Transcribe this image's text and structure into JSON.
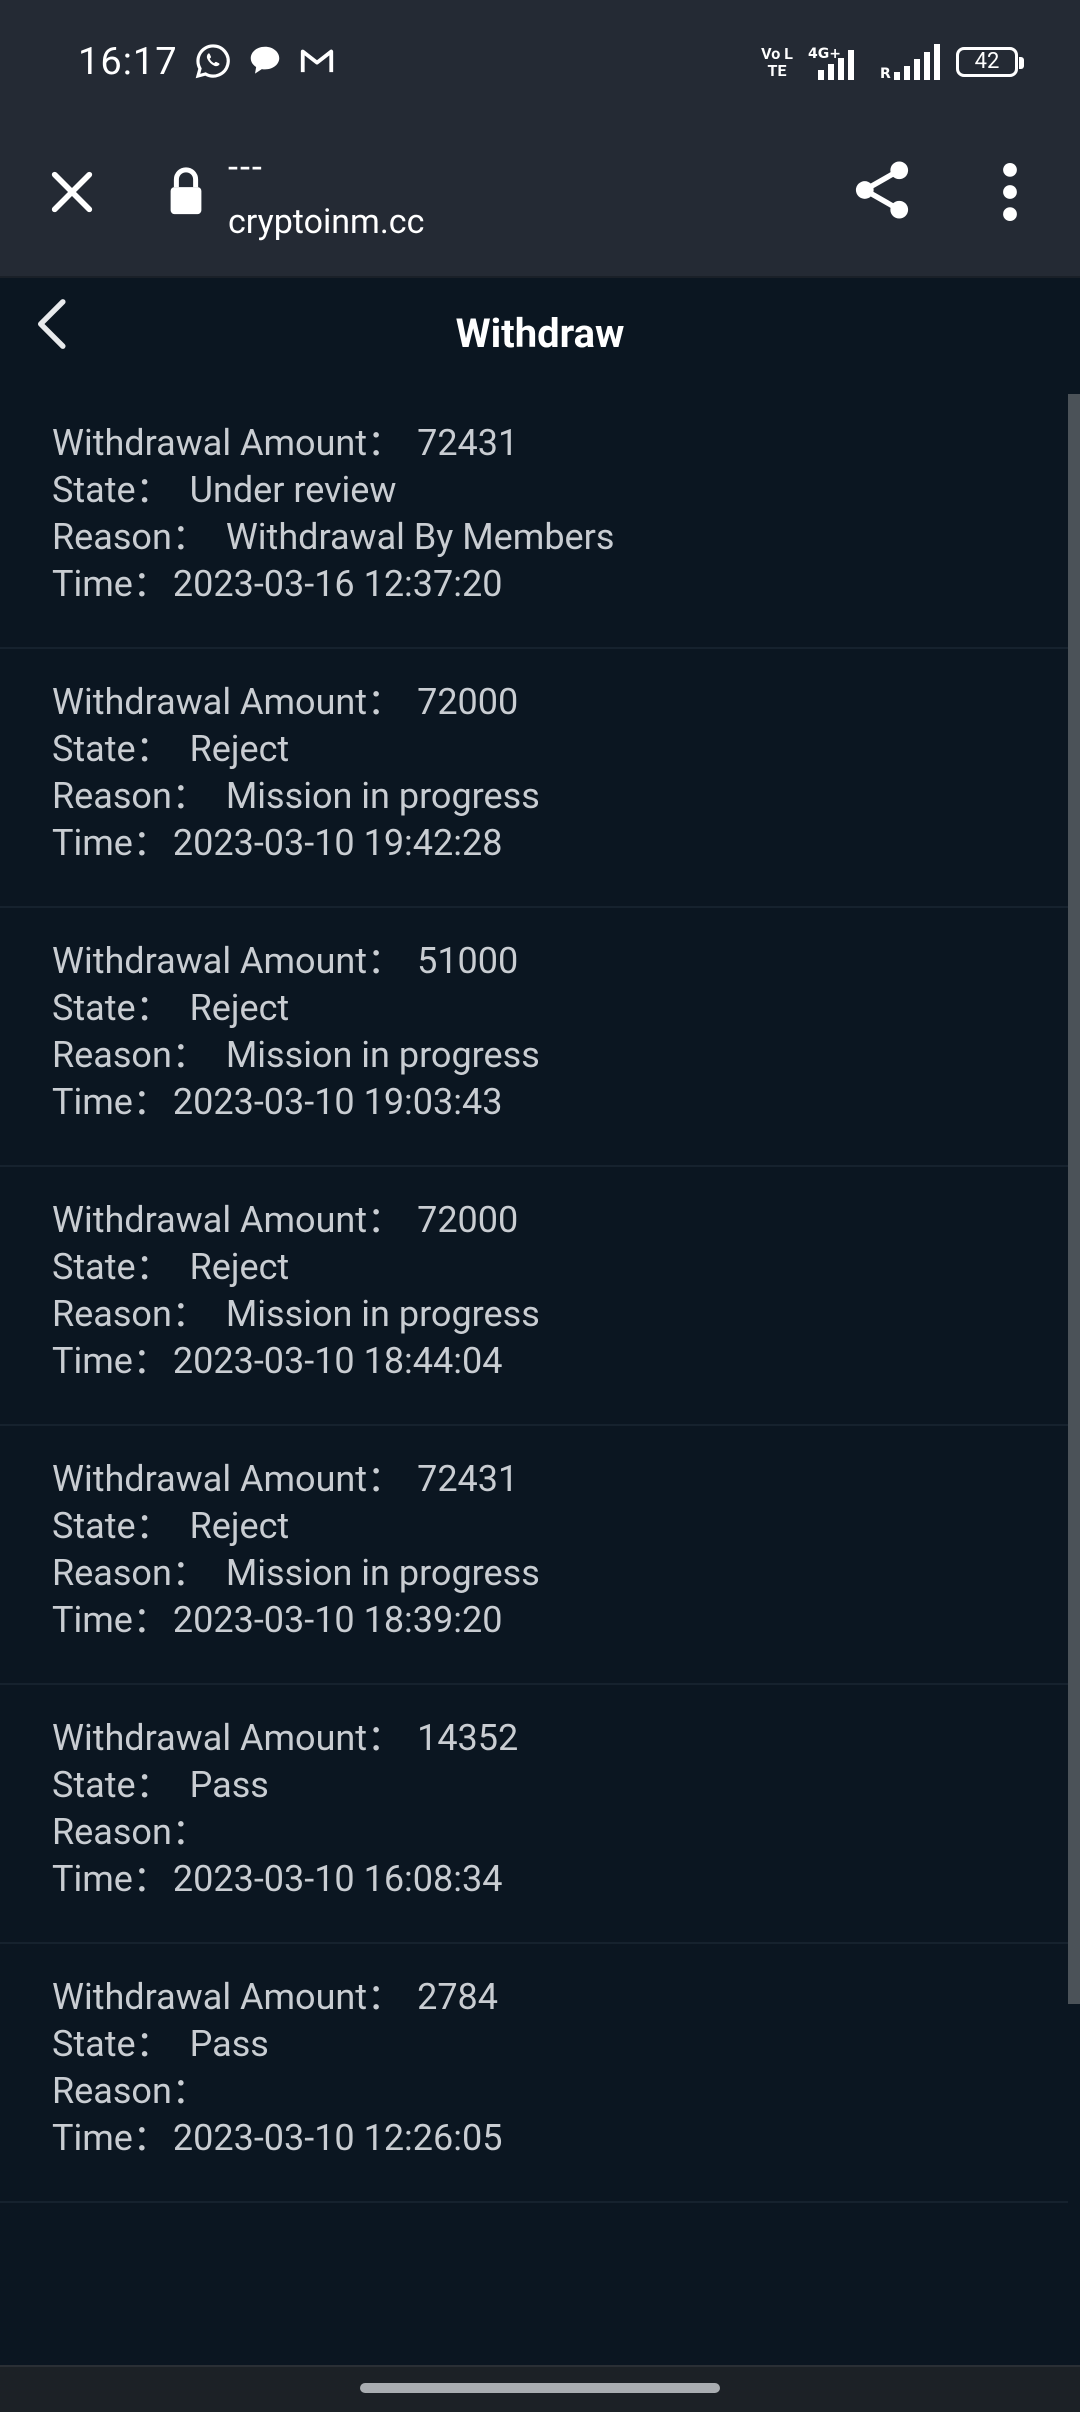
{
  "status_bar": {
    "time": "16:17",
    "volte_label": "Vo LTE",
    "network_label": "4G+",
    "battery_level": "42"
  },
  "browser": {
    "page_title": "---",
    "url": "cryptoinm.cc"
  },
  "header": {
    "title": "Withdraw"
  },
  "labels": {
    "amount": "Withdrawal Amount：",
    "state": "State：",
    "reason": "Reason：",
    "time": "Time："
  },
  "records": [
    {
      "amount": "72431",
      "state": "Under review",
      "reason": "Withdrawal By Members",
      "time": "2023-03-16 12:37:20"
    },
    {
      "amount": "72000",
      "state": "Reject",
      "reason": "Mission in progress",
      "time": "2023-03-10 19:42:28"
    },
    {
      "amount": "51000",
      "state": "Reject",
      "reason": "Mission in progress",
      "time": "2023-03-10 19:03:43"
    },
    {
      "amount": "72000",
      "state": "Reject",
      "reason": "Mission in progress",
      "time": "2023-03-10 18:44:04"
    },
    {
      "amount": "72431",
      "state": "Reject",
      "reason": "Mission in progress",
      "time": "2023-03-10 18:39:20"
    },
    {
      "amount": "14352",
      "state": "Pass",
      "reason": "",
      "time": "2023-03-10 16:08:34"
    },
    {
      "amount": "2784",
      "state": "Pass",
      "reason": "",
      "time": "2023-03-10 12:26:05"
    }
  ],
  "icons": {
    "status": [
      "whatsapp-icon",
      "chat-bubble-icon",
      "gmail-icon",
      "signal-icon",
      "battery-icon"
    ],
    "browser": [
      "close-icon",
      "lock-icon",
      "share-icon",
      "more-vert-icon"
    ],
    "header": [
      "chevron-left-icon"
    ]
  }
}
